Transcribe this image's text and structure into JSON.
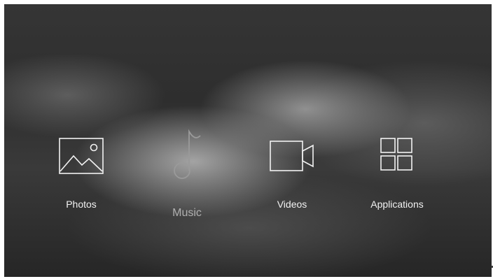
{
  "menu": {
    "items": [
      {
        "label": "Photos",
        "icon": "photo-icon"
      },
      {
        "label": "Music",
        "icon": "music-note-icon",
        "selected": true
      },
      {
        "label": "Videos",
        "icon": "video-camera-icon"
      },
      {
        "label": "Applications",
        "icon": "apps-grid-icon"
      }
    ]
  },
  "colors": {
    "background": "#303030",
    "label": "#f2f2f2",
    "selected_label": "#b0b0b0",
    "icon_stroke": "#f2f2f2",
    "selected_icon_stroke": "#9a9a9a"
  }
}
